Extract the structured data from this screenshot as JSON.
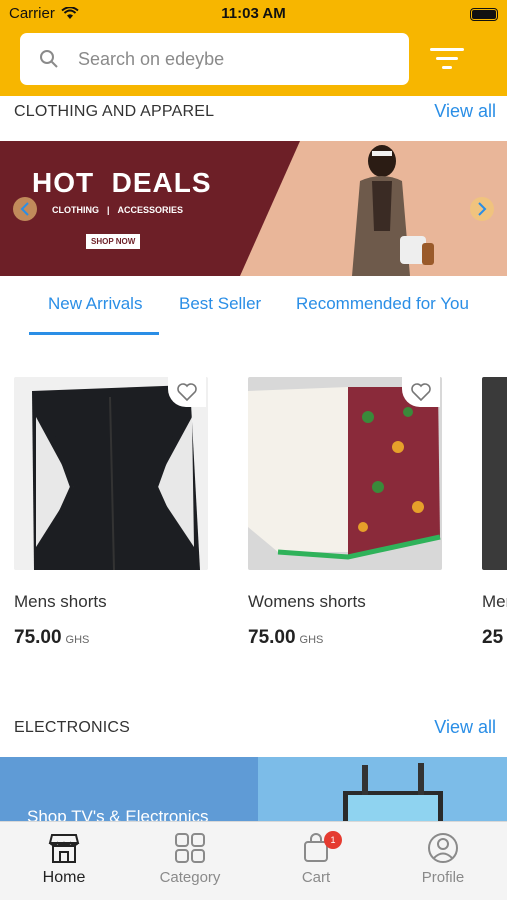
{
  "status_bar": {
    "carrier": "Carrier",
    "time": "11:03 AM"
  },
  "search": {
    "placeholder": "Search on edeybe"
  },
  "sections": {
    "clothing": {
      "title": "CLOTHING AND APPAREL",
      "view_all": "View all"
    },
    "electronics": {
      "title": "ELECTRONICS",
      "view_all": "View all"
    }
  },
  "banner": {
    "headline": "HOT  DEALS",
    "tags": [
      "CLOTHING",
      "|",
      "ACCESSORIES"
    ],
    "cta": "SHOP NOW"
  },
  "tabs": [
    "New Arrivals",
    "Best Seller",
    "Recommended for You"
  ],
  "products": [
    {
      "name": "Mens shorts",
      "price": "75.00",
      "currency": "GHS"
    },
    {
      "name": "Womens shorts",
      "price": "75.00",
      "currency": "GHS"
    },
    {
      "name": "Mer",
      "price": "25",
      "currency": ""
    }
  ],
  "electronics_banner": {
    "caption": "Shop TV's & Electronics"
  },
  "bottom_nav": [
    {
      "label": "Home",
      "icon": "store-icon"
    },
    {
      "label": "Category",
      "icon": "grid-icon"
    },
    {
      "label": "Cart",
      "icon": "cart-icon",
      "badge": "1"
    },
    {
      "label": "Profile",
      "icon": "user-icon"
    }
  ],
  "colors": {
    "brand": "#f7b600",
    "accent": "#2a8ee6",
    "banner": "#6d1f27",
    "badge": "#e53b30"
  }
}
